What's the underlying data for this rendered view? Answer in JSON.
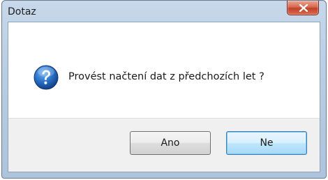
{
  "window": {
    "title": "Dotaz"
  },
  "dialog": {
    "icon": "question-icon",
    "message": "Provést načtení dat z předchozích let ?"
  },
  "buttons": {
    "yes_label": "Ano",
    "no_label": "Ne"
  },
  "colors": {
    "title_bar": "#b9cde3",
    "close_button": "#c1412a",
    "footer": "#f0f0f0",
    "icon_blue": "#1d5fb0",
    "default_button_border": "#3c7fb1"
  }
}
